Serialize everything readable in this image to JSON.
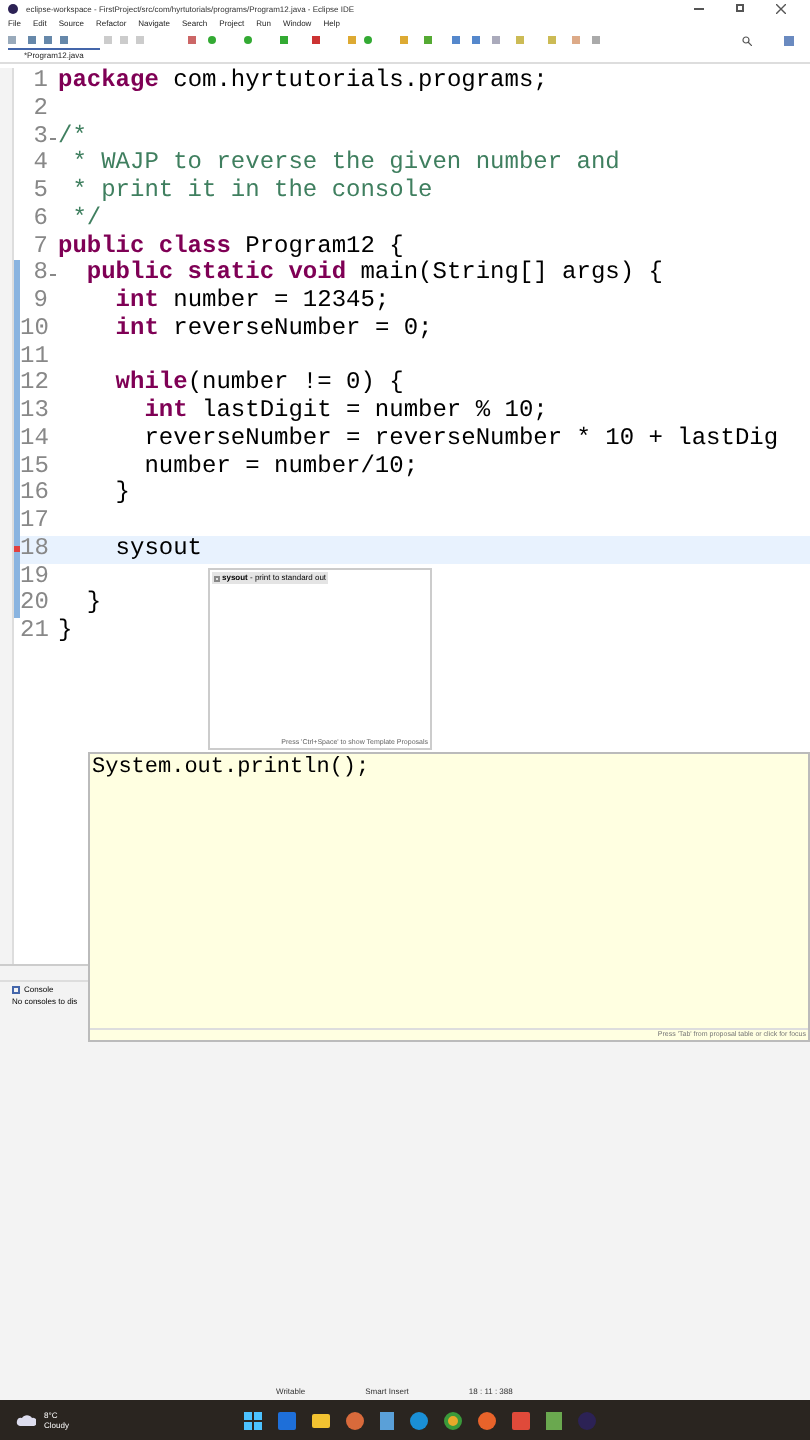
{
  "window": {
    "title": "eclipse-workspace - FirstProject/src/com/hyrtutorials/programs/Program12.java - Eclipse IDE"
  },
  "menu": [
    "File",
    "Edit",
    "Source",
    "Refactor",
    "Navigate",
    "Search",
    "Project",
    "Run",
    "Window",
    "Help"
  ],
  "editor_tab": {
    "label": "*Program12.java",
    "selected": true
  },
  "code_lines": [
    {
      "number": "1",
      "fold": false,
      "changed": false,
      "current": false,
      "error": false,
      "segments": [
        {
          "kind": "keyword",
          "text": "package"
        },
        {
          "kind": "plain",
          "text": " com.hyrtutorials.programs;"
        }
      ]
    },
    {
      "number": "2",
      "fold": false,
      "changed": false,
      "current": false,
      "error": false
    },
    {
      "number": "3",
      "fold": true,
      "changed": false,
      "current": false,
      "error": false,
      "segments": [
        {
          "kind": "comment",
          "text": "/*"
        }
      ]
    },
    {
      "number": "4",
      "fold": false,
      "changed": false,
      "current": false,
      "error": false,
      "segments": [
        {
          "kind": "comment",
          "text": " * WAJP to reverse the given number and"
        }
      ]
    },
    {
      "number": "5",
      "fold": false,
      "changed": false,
      "current": false,
      "error": false,
      "segments": [
        {
          "kind": "comment",
          "text": " * print it in the console"
        }
      ]
    },
    {
      "number": "6",
      "fold": false,
      "changed": false,
      "current": false,
      "error": false,
      "segments": [
        {
          "kind": "comment",
          "text": " */"
        }
      ]
    },
    {
      "number": "7",
      "fold": false,
      "changed": false,
      "current": false,
      "error": false,
      "segments": [
        {
          "kind": "keyword",
          "text": "public class"
        },
        {
          "kind": "plain",
          "text": " Program12 {"
        }
      ]
    },
    {
      "number": "8",
      "fold": true,
      "changed": true,
      "current": false,
      "error": false,
      "segments": [
        {
          "kind": "keyword",
          "text": "  public static void"
        },
        {
          "kind": "plain",
          "text": " main(String[] args) {"
        }
      ]
    },
    {
      "number": "9",
      "fold": false,
      "changed": true,
      "current": false,
      "error": false,
      "segments": [
        {
          "kind": "keyword",
          "text": "    int"
        },
        {
          "kind": "plain",
          "text": " number = 12345;"
        }
      ]
    },
    {
      "number": "10",
      "fold": false,
      "changed": true,
      "current": false,
      "error": false,
      "segments": [
        {
          "kind": "keyword",
          "text": "    int"
        },
        {
          "kind": "plain",
          "text": " reverseNumber = 0;"
        }
      ]
    },
    {
      "number": "11",
      "fold": false,
      "changed": true,
      "current": false,
      "error": false
    },
    {
      "number": "12",
      "fold": false,
      "changed": true,
      "current": false,
      "error": false,
      "segments": [
        {
          "kind": "keyword",
          "text": "    while"
        },
        {
          "kind": "plain",
          "text": "(number != 0) {"
        }
      ]
    },
    {
      "number": "13",
      "fold": false,
      "changed": true,
      "current": false,
      "error": false,
      "segments": [
        {
          "kind": "keyword",
          "text": "      int"
        },
        {
          "kind": "plain",
          "text": " lastDigit = number % 10;"
        }
      ]
    },
    {
      "number": "14",
      "fold": false,
      "changed": true,
      "current": false,
      "error": false,
      "segments": [
        {
          "kind": "plain",
          "text": "      reverseNumber = reverseNumber * 10 + lastDig"
        }
      ]
    },
    {
      "number": "15",
      "fold": false,
      "changed": true,
      "current": false,
      "error": false,
      "segments": [
        {
          "kind": "plain",
          "text": "      number = number/10;"
        }
      ]
    },
    {
      "number": "16",
      "fold": false,
      "changed": true,
      "current": false,
      "error": false,
      "segments": [
        {
          "kind": "plain",
          "text": "    }"
        }
      ]
    },
    {
      "number": "17",
      "fold": false,
      "changed": true,
      "current": false,
      "error": false
    },
    {
      "number": "18",
      "fold": false,
      "changed": true,
      "current": true,
      "error": true,
      "segments": [
        {
          "kind": "plain",
          "text": "    sysout"
        }
      ]
    },
    {
      "number": "19",
      "fold": false,
      "changed": true,
      "current": false,
      "error": false
    },
    {
      "number": "20",
      "fold": false,
      "changed": true,
      "current": false,
      "error": false,
      "segments": [
        {
          "kind": "plain",
          "text": "  }"
        }
      ]
    },
    {
      "number": "21",
      "fold": false,
      "changed": false,
      "current": false,
      "error": false,
      "segments": [
        {
          "kind": "plain",
          "text": "}"
        }
      ]
    }
  ],
  "proposals": {
    "items": [
      {
        "text": "**sysout** - print to standard out",
        "selected": true
      }
    ],
    "footer": "Press 'Ctrl+Space' to show Template Proposals"
  },
  "proposal_preview": {
    "text": "System.out.println();",
    "footer": "Press 'Tab' from proposal table or click for focus"
  },
  "console": {
    "tab": "Console",
    "message": "No consoles to dis"
  },
  "status_bar": [
    "Writable",
    "Smart Insert",
    "18 : 11 : 388"
  ],
  "taskbar": {
    "temperature": "8°C",
    "weather": "Cloudy"
  }
}
